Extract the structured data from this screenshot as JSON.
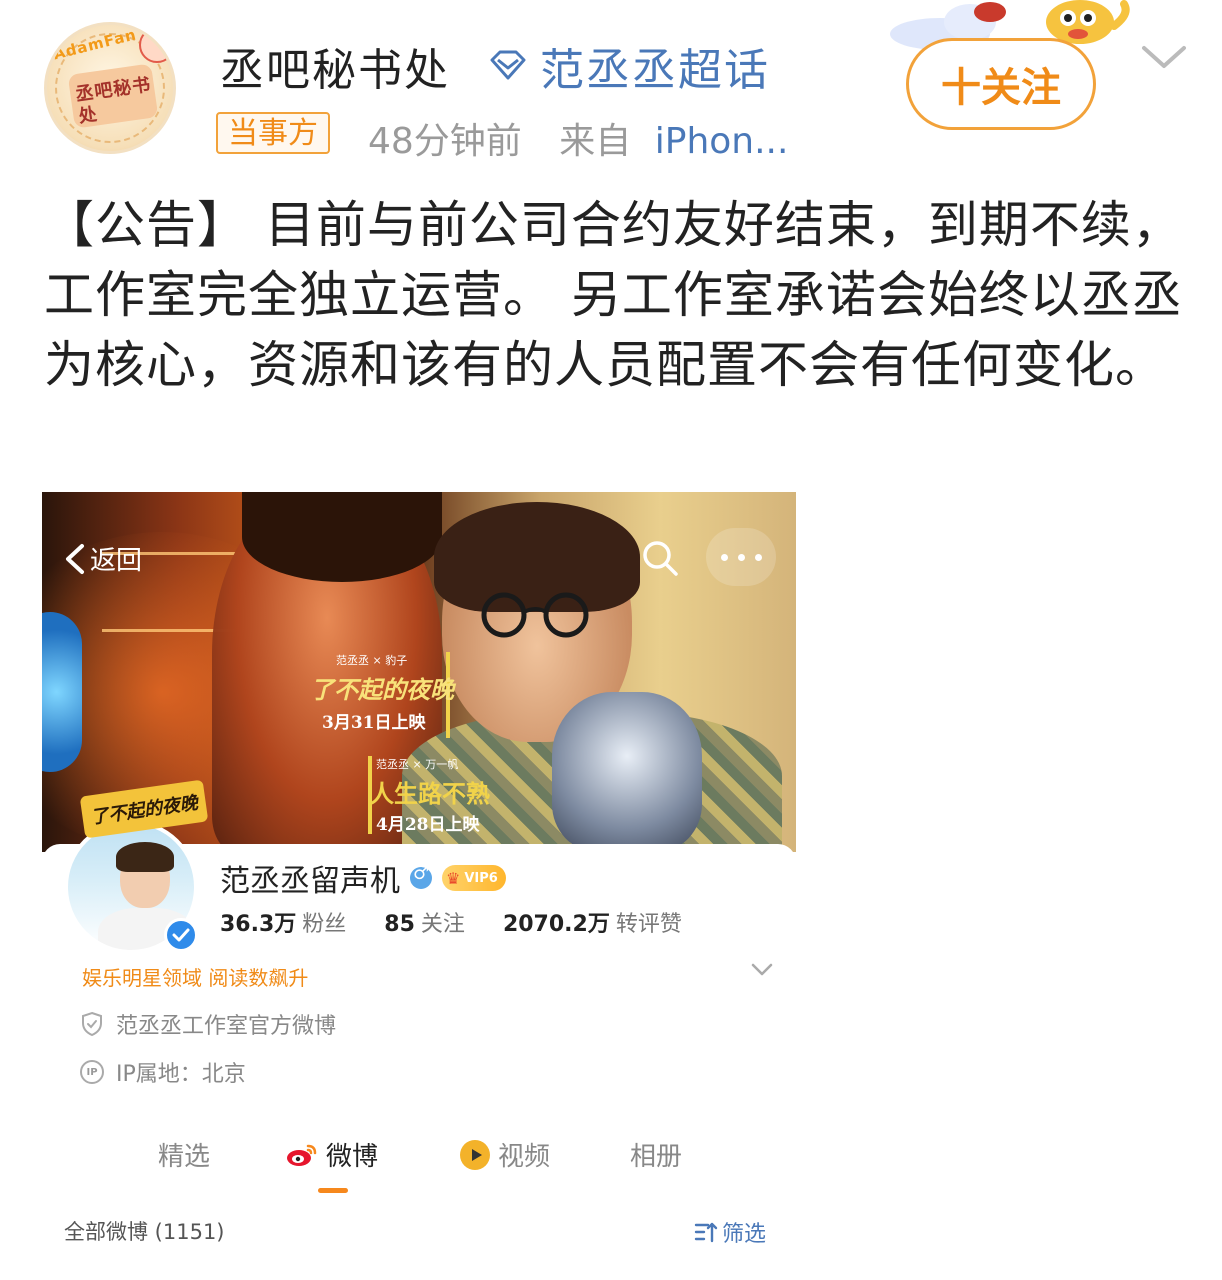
{
  "post": {
    "author": "丞吧秘书处",
    "super_topic": "范丞丞超话",
    "badge": "当事方",
    "time": "48分钟前",
    "source_prefix": "来自",
    "source": "iPhon...",
    "follow_label": "十关注",
    "avatar_text": "丞吧秘书处",
    "avatar_ribbon": "AdamFan",
    "body": "【公告】  目前与前公司合约友好结束，到期不续，工作室完全独立运营。 另工作室承诺会始终以丞丞为核心，资源和该有的人员配置不会有任何变化。"
  },
  "embed": {
    "back_label": "返回",
    "banner": {
      "poster1_credits": "范丞丞 × 豹子",
      "poster1_title": "了不起的夜晚",
      "poster1_date": "3月31日上映",
      "poster2_credits": "范丞丞 × 万一帆",
      "poster2_title": "人生路不熟",
      "poster2_date": "4月28日上映"
    },
    "avatar_frame_label": "了不起的夜晚",
    "profile": {
      "name": "范丞丞留声机",
      "vip_label": "VIP6",
      "stats": [
        {
          "num": "36.3万",
          "label": "粉丝"
        },
        {
          "num": "85",
          "label": "关注"
        },
        {
          "num": "2070.2万",
          "label": "转评赞"
        }
      ],
      "domain": "娱乐明星领域 阅读数飙升",
      "verification": "范丞丞工作室官方微博",
      "ip": "IP属地：北京"
    },
    "tabs": [
      "精选",
      "微博",
      "视频",
      "相册"
    ],
    "active_tab": "微博",
    "all_posts": "全部微博 (1151)",
    "filter_label": "筛选"
  },
  "colors": {
    "accent_orange": "#f08b18",
    "link_blue": "#4a78b8",
    "verified_blue": "#2f8bea"
  },
  "icons": [
    "diamond-icon",
    "chevron-down-icon",
    "back-arrow-icon",
    "search-icon",
    "more-icon",
    "verified-icon",
    "male-icon",
    "vip-crown-icon",
    "shield-icon",
    "ip-icon",
    "weibo-icon",
    "video-icon",
    "filter-icon"
  ]
}
